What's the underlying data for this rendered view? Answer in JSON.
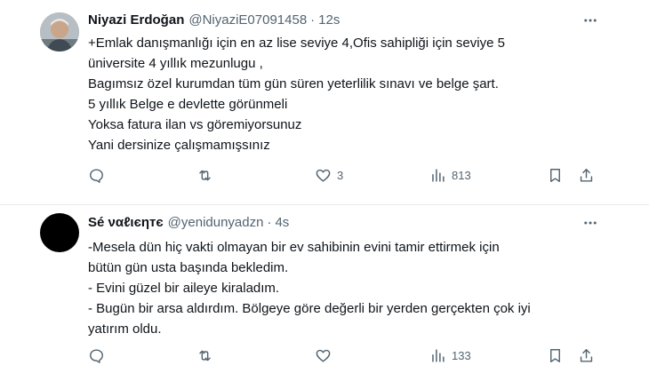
{
  "tweets": [
    {
      "author_name": "Niyazi Erdoğan",
      "handle": "@NiyaziE07091458",
      "separator": "·",
      "time": "12s",
      "lines": [
        "+Emlak danışmanlığı için en az lise seviye 4,Ofis sahipliği için seviye 5",
        "üniversite 4 yıllık mezunlugu ,",
        "Bagımsız özel kurumdan tüm gün süren yeterlilik sınavı ve belge şart.",
        "5 yıllık Belge e devlette görünmeli",
        "Yoksa fatura ilan vs göremiyorsunuz",
        "Yani dersinize çalışmamışsınız"
      ],
      "reply_count": "",
      "retweet_count": "",
      "like_count": "3",
      "view_count": "813"
    },
    {
      "author_name": "Sé ναℓιєηтє",
      "handle": "@yenidunyadzn",
      "separator": "·",
      "time": "4s",
      "lines": [
        "-Mesela dün hiç vakti olmayan bir ev sahibinin evini tamir ettirmek için",
        "bütün gün usta başında bekledim.",
        "- Evini güzel bir aileye kiraladım.",
        "- Bugün bir arsa aldırdım. Bölgeye göre değerli bir yerden gerçekten çok iyi",
        "yatırım oldu."
      ],
      "reply_count": "",
      "retweet_count": "",
      "like_count": "",
      "view_count": "133"
    }
  ],
  "icons": {
    "more": "more-horizontal-icon",
    "reply": "reply-bubble-icon",
    "retweet": "retweet-icon",
    "like": "heart-icon",
    "views": "views-bar-chart-icon",
    "bookmark": "bookmark-icon",
    "share": "share-upload-icon"
  },
  "colors": {
    "text_primary": "#0f1419",
    "text_secondary": "#536471",
    "divider": "#e6ecf0",
    "background": "#ffffff"
  }
}
